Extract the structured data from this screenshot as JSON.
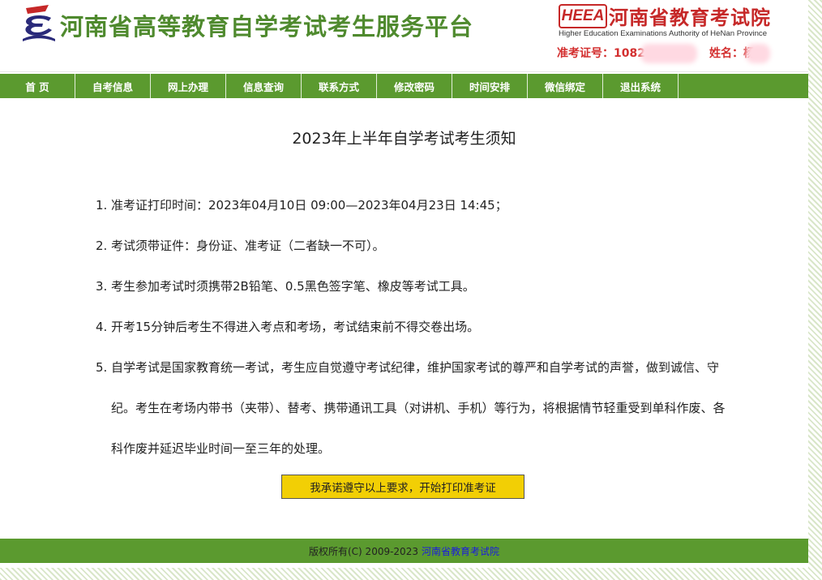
{
  "header": {
    "site_title": "河南省高等教育自学考试考生服务平台",
    "authority_badge": "HEEA",
    "authority_cn": "河南省教育考试院",
    "authority_en": "Higher Education Examinations Authority of HeNan Province",
    "ticket_label": "准考证号：1082",
    "name_label": "姓名：杨"
  },
  "nav": {
    "items": [
      "首  页",
      "自考信息",
      "网上办理",
      "信息查询",
      "联系方式",
      "修改密码",
      "时间安排",
      "微信绑定",
      "退出系统"
    ]
  },
  "notice": {
    "title": "2023年上半年自学考试考生须知",
    "items": [
      {
        "num": "1.",
        "text": "准考证打印时间：2023年04月10日 09:00—2023年04月23日 14:45；"
      },
      {
        "num": "2.",
        "text": "考试须带证件：身份证、准考证（二者缺一不可）。"
      },
      {
        "num": "3.",
        "text": "考生参加考试时须携带2B铅笔、0.5黑色签字笔、橡皮等考试工具。"
      },
      {
        "num": "4.",
        "text": "开考15分钟后考生不得进入考点和考场，考试结束前不得交卷出场。"
      },
      {
        "num": "5.",
        "text": "自学考试是国家教育统一考试，考生应自觉遵守考试纪律，维护国家考试的尊严和自学考试的声誉，做到诚信、守纪。考生在考场内带书（夹带）、替考、携带通讯工具（对讲机、手机）等行为，将根据情节轻重受到单科作废、各科作废并延迟毕业时间一至三年的处理。"
      }
    ],
    "confirm_button": "我承诺遵守以上要求，开始打印准考证"
  },
  "footer": {
    "copyright": "版权所有(C) 2009-2023",
    "link": "河南省教育考试院"
  },
  "colors": {
    "brand_green": "#5b9a2f",
    "title_green": "#4f8a2e",
    "accent_red": "#c62828",
    "button_yellow": "#f2cf05"
  }
}
